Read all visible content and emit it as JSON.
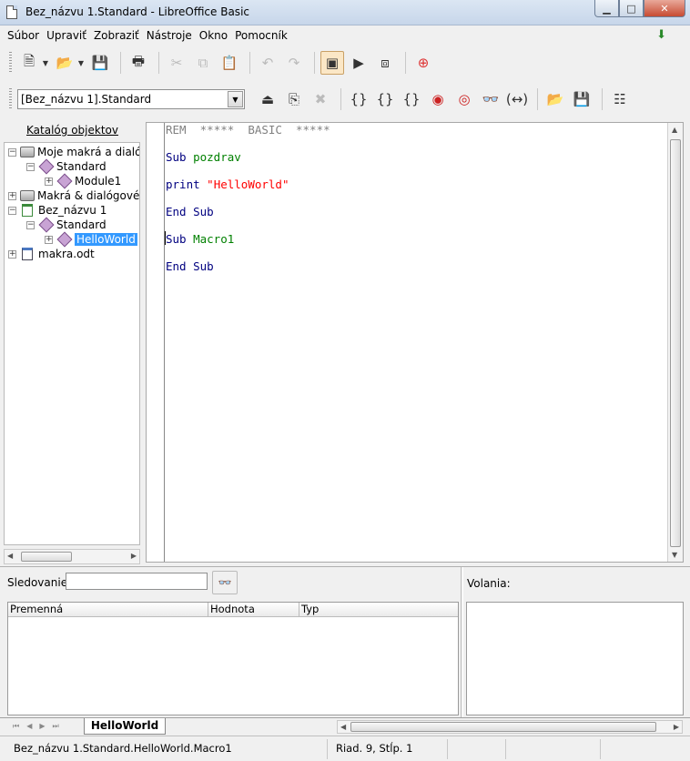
{
  "window": {
    "title": "Bez_názvu 1.Standard - LibreOffice Basic"
  },
  "menu": [
    "Súbor",
    "Upraviť",
    "Zobraziť",
    "Nástroje",
    "Okno",
    "Pomocník"
  ],
  "library_selector": {
    "value": "[Bez_názvu 1].Standard"
  },
  "catalog": {
    "title": "Katalóg objektov",
    "nodes": {
      "my_macros": "Moje makrá a dialógy",
      "my_standard": "Standard",
      "module1": "Module1",
      "lo_macros": "Makrá & dialógové",
      "doc": "Bez_názvu 1",
      "doc_standard": "Standard",
      "helloworld": "HelloWorld",
      "makra": "makra.odt"
    }
  },
  "code": {
    "line1": {
      "rem": "REM",
      "comment": "*****  BASIC  *****"
    },
    "line3": {
      "kw": "Sub",
      "name": "pozdrav"
    },
    "line5": {
      "kw": "print",
      "str": "\"HelloWorld\""
    },
    "line7": {
      "kw": "End Sub"
    },
    "line9": {
      "kw": "Sub",
      "name": "Macro1"
    },
    "line11": {
      "kw": "End Sub"
    }
  },
  "watch": {
    "label": "Sledovanie:",
    "value": "",
    "columns": [
      "Premenná",
      "Hodnota",
      "Typ"
    ]
  },
  "calls": {
    "label": "Volania:"
  },
  "tabs": {
    "active": "HelloWorld"
  },
  "status": {
    "location": "Bez_názvu 1.Standard.HelloWorld.Macro1",
    "position": "Riad. 9, Stĺp. 1"
  }
}
